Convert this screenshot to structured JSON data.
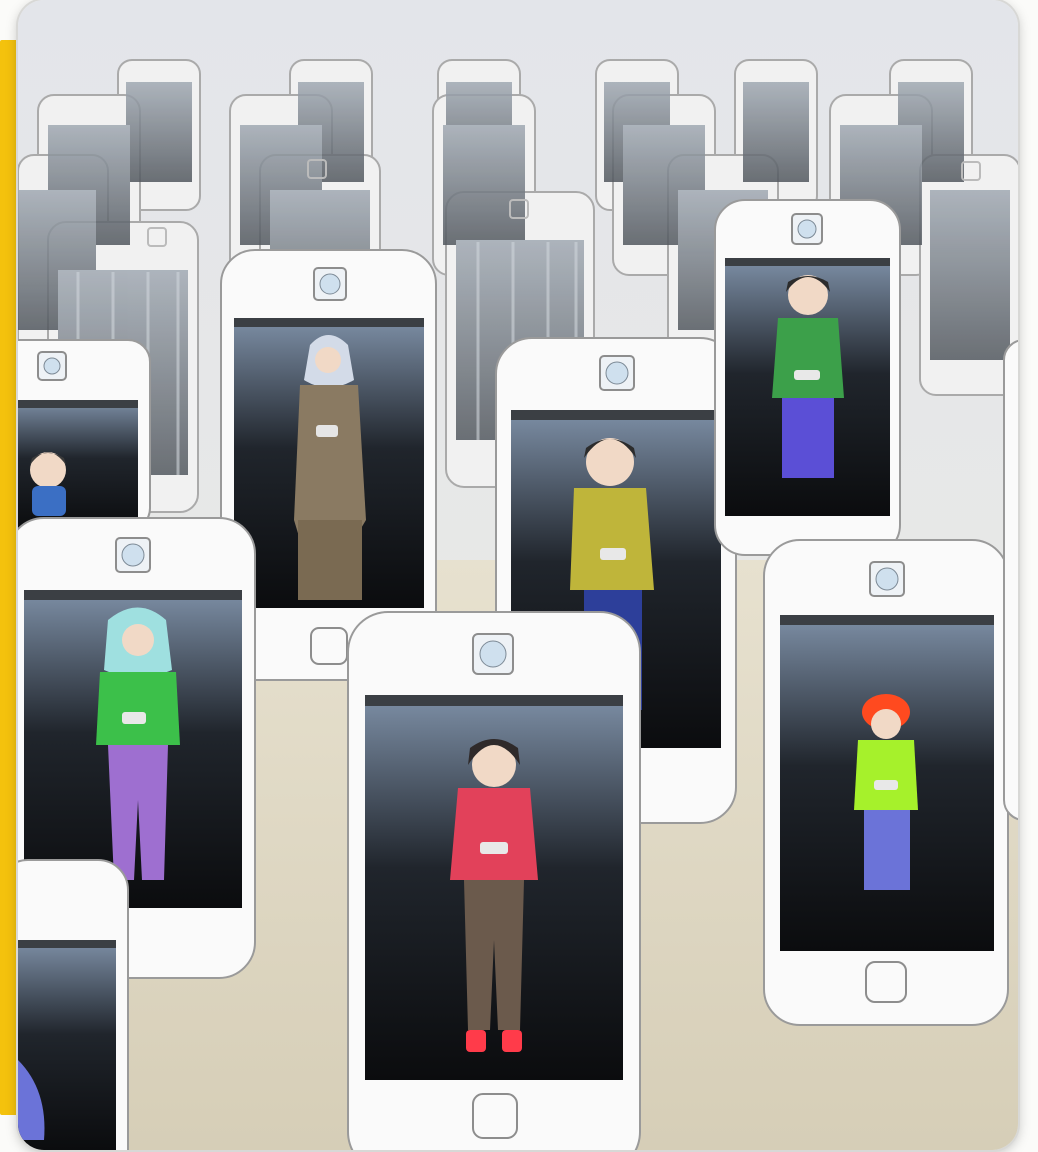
{
  "image": {
    "subject": "cartoon",
    "elements": {
      "phone_count_foreground": 8,
      "phone_count_background": 20
    }
  },
  "colors": {
    "frame_accent": "#f4c20d",
    "floor": "#d9d2bd",
    "wall": "#e6e7ec",
    "phone_body": "#fafafa",
    "phone_outline": "#9a9a9a",
    "screen_dark": "#121417",
    "bars": "#b9c2cc"
  },
  "people": [
    {
      "id": "brown-robe-hijab",
      "top": "#8a7a62",
      "bottom": "#7a6a52",
      "hair": "#cfd7e6"
    },
    {
      "id": "yellow-shirt-boy",
      "top": "#bfb53a",
      "bottom": "#2d3f9a",
      "hair": "#2c2c2c"
    },
    {
      "id": "green-shirt-man",
      "top": "#3ca04a",
      "bottom": "#5b4fd6",
      "hair": "#2c2c2c"
    },
    {
      "id": "child-left",
      "top": "#3b6fc4",
      "bottom": "#3b6fc4",
      "hair": "#3a3a3a"
    },
    {
      "id": "teal-hijab-girl",
      "top": "#3cc04a",
      "bottom": "#9e6fd0",
      "hair": "#9fe0e0"
    },
    {
      "id": "pink-sweater-girl",
      "top": "#e2415a",
      "bottom": "#6b5a4c",
      "hair": "#2f2a2a"
    },
    {
      "id": "red-hair-child",
      "top": "#a6f12b",
      "bottom": "#6b73d8",
      "hair": "#ff4a1f"
    }
  ]
}
